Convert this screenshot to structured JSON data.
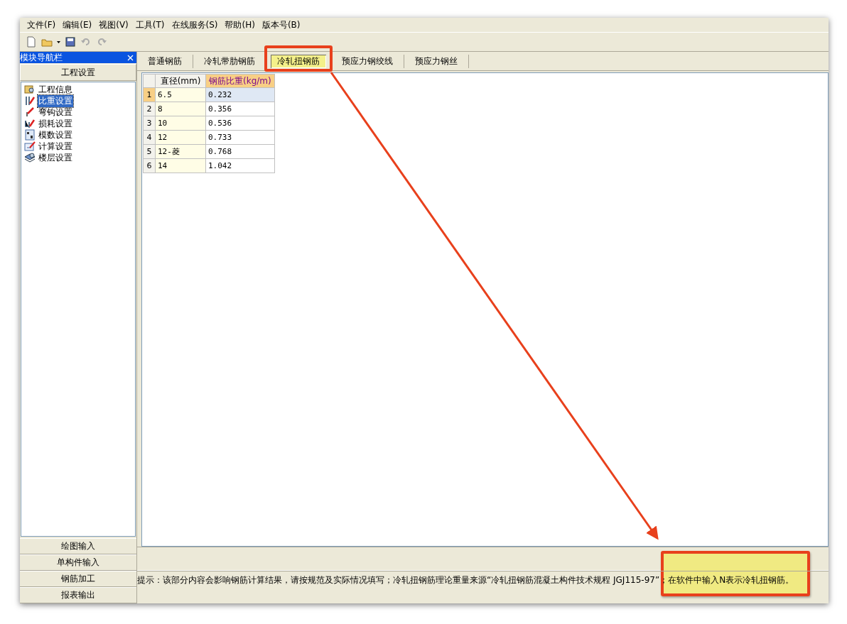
{
  "menu": [
    "文件(F)",
    "编辑(E)",
    "视图(V)",
    "工具(T)",
    "在线服务(S)",
    "帮助(H)",
    "版本号(B)"
  ],
  "nav": {
    "title": "模块导航栏",
    "section": "工程设置",
    "items": [
      {
        "label": "工程信息",
        "selected": false
      },
      {
        "label": "比重设置",
        "selected": true
      },
      {
        "label": "弯钩设置",
        "selected": false
      },
      {
        "label": "损耗设置",
        "selected": false
      },
      {
        "label": "模数设置",
        "selected": false
      },
      {
        "label": "计算设置",
        "selected": false
      },
      {
        "label": "楼层设置",
        "selected": false
      }
    ],
    "modules": [
      "绘图输入",
      "单构件输入",
      "钢筋加工",
      "报表输出"
    ]
  },
  "tabs": [
    {
      "label": "普通钢筋",
      "selected": false
    },
    {
      "label": "冷轧带肋钢筋",
      "selected": false
    },
    {
      "label": "冷轧扭钢筋",
      "selected": true
    },
    {
      "label": "预应力钢绞线",
      "selected": false
    },
    {
      "label": "预应力钢丝",
      "selected": false
    }
  ],
  "table": {
    "columns": [
      {
        "label": "直径(mm)",
        "selected": false
      },
      {
        "label": "钢筋比重(kg/m)",
        "selected": true
      }
    ],
    "rows": [
      {
        "number": "1",
        "cells": [
          "6.5",
          "0.232"
        ],
        "selected": true
      },
      {
        "number": "2",
        "cells": [
          "8",
          "0.356"
        ],
        "selected": false
      },
      {
        "number": "3",
        "cells": [
          "10",
          "0.536"
        ],
        "selected": false
      },
      {
        "number": "4",
        "cells": [
          "12",
          "0.733"
        ],
        "selected": false
      },
      {
        "number": "5",
        "cells": [
          "12-菱",
          "0.768"
        ],
        "selected": false
      },
      {
        "number": "6",
        "cells": [
          "14",
          "1.042"
        ],
        "selected": false
      }
    ]
  },
  "hint": "提示：该部分内容会影响钢筋计算结果，请按规范及实际情况填写；冷轧扭钢筋理论重量来源“冷轧扭钢筋混凝土构件技术规程 JGJ115-97”；在软件中输入N表示冷轧扭钢筋。"
}
